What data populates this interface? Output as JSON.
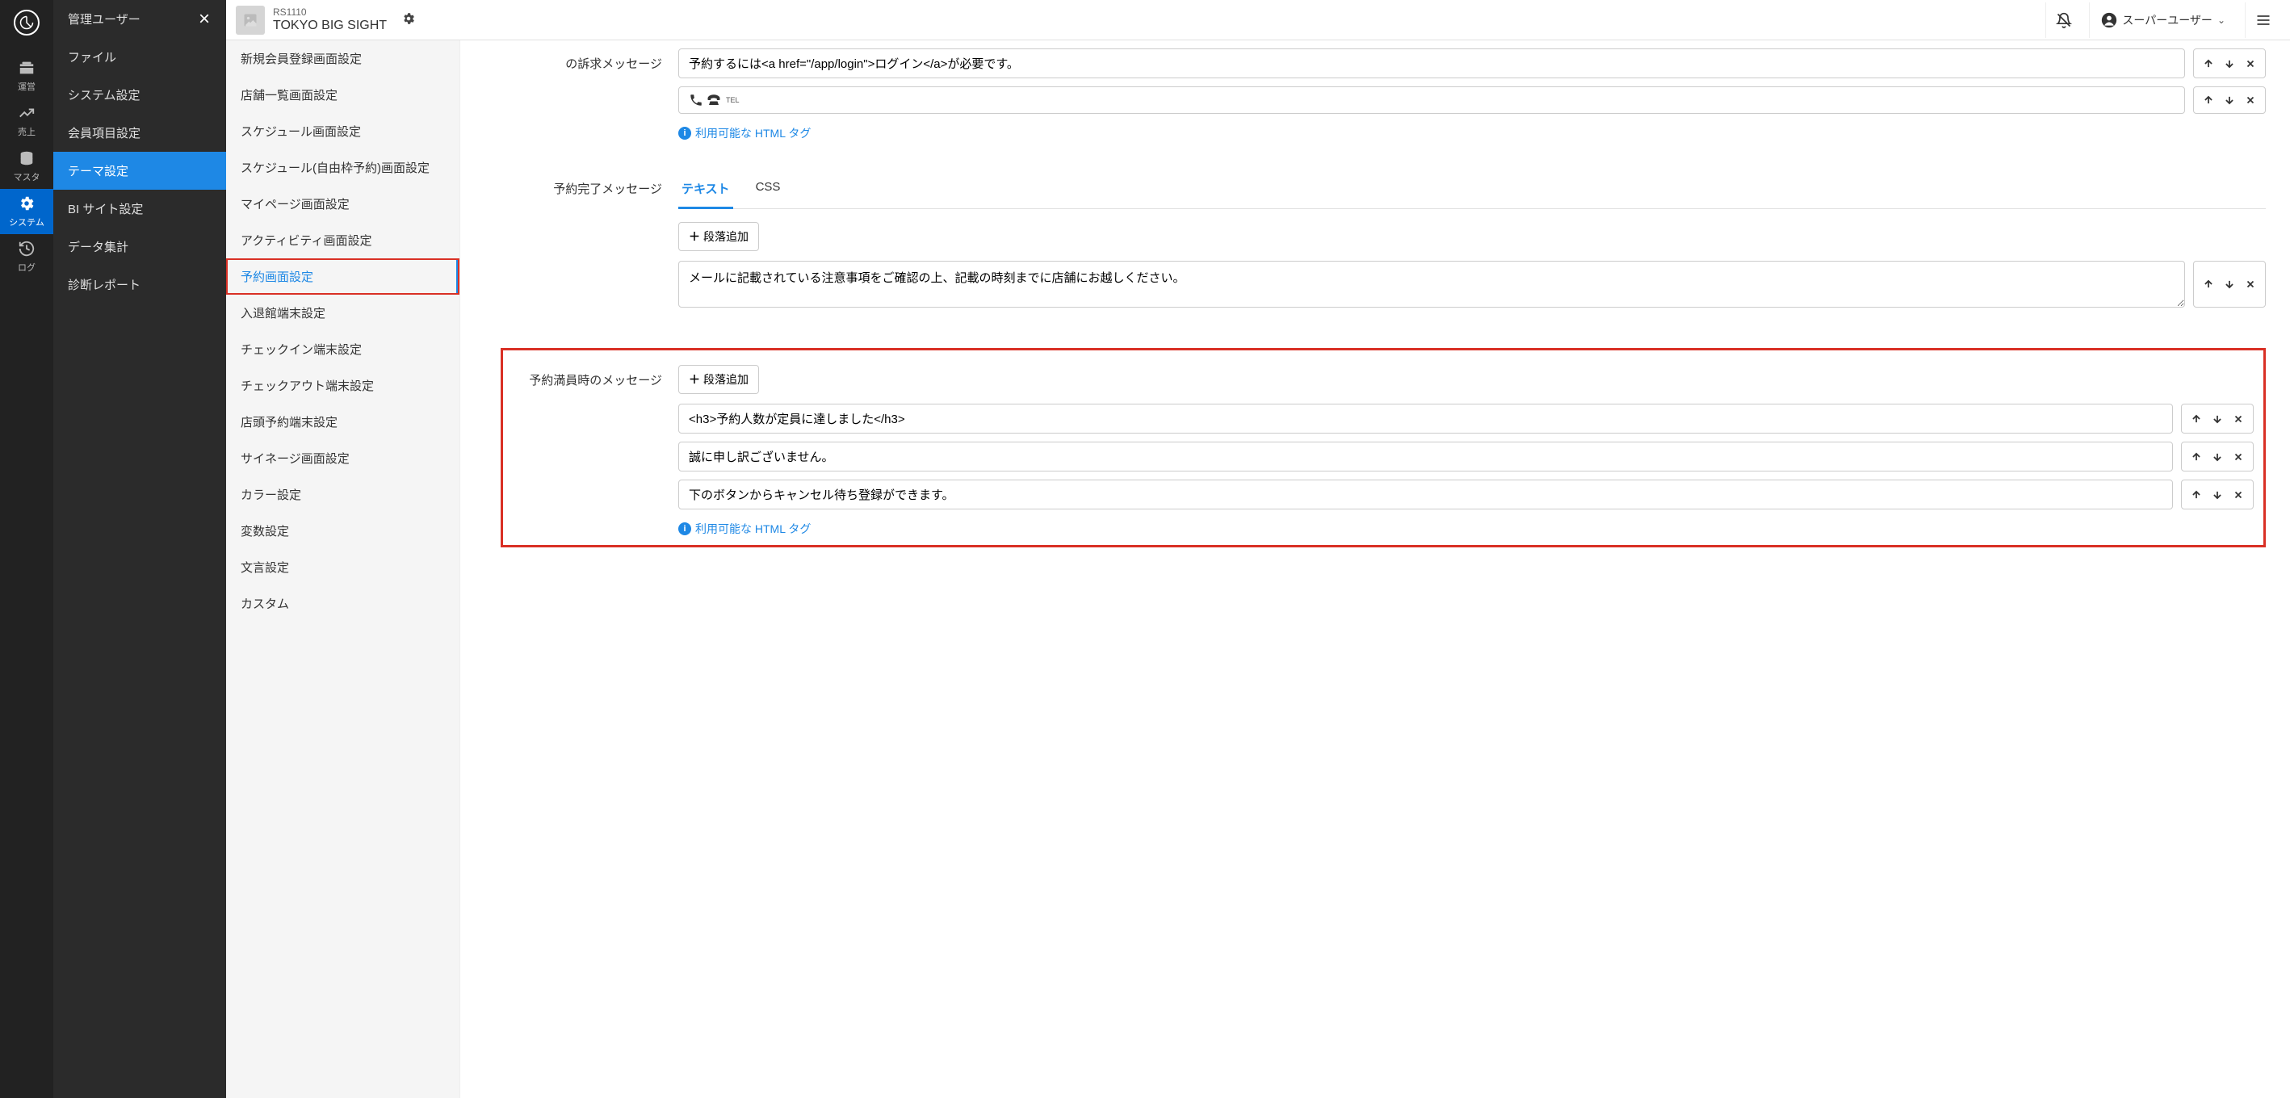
{
  "topbar": {
    "code": "RS1110",
    "name": "TOKYO BIG SIGHT",
    "thumb_label": "No image",
    "user_label": "スーパーユーザー"
  },
  "icon_nav": [
    {
      "label": "運営"
    },
    {
      "label": "売上"
    },
    {
      "label": "マスタ"
    },
    {
      "label": "システム"
    },
    {
      "label": "ログ"
    }
  ],
  "second_nav": [
    {
      "label": "管理ユーザー"
    },
    {
      "label": "ファイル"
    },
    {
      "label": "システム設定"
    },
    {
      "label": "会員項目設定"
    },
    {
      "label": "テーマ設定"
    },
    {
      "label": "BI サイト設定"
    },
    {
      "label": "データ集計"
    },
    {
      "label": "診断レポート"
    }
  ],
  "third_nav": [
    {
      "label": "新規会員登録画面設定"
    },
    {
      "label": "店舗一覧画面設定"
    },
    {
      "label": "スケジュール画面設定"
    },
    {
      "label": "スケジュール(自由枠予約)画面設定"
    },
    {
      "label": "マイページ画面設定"
    },
    {
      "label": "アクティビティ画面設定"
    },
    {
      "label": "予約画面設定"
    },
    {
      "label": "入退館端末設定"
    },
    {
      "label": "チェックイン端末設定"
    },
    {
      "label": "チェックアウト端末設定"
    },
    {
      "label": "店頭予約端末設定"
    },
    {
      "label": "サイネージ画面設定"
    },
    {
      "label": "カラー設定"
    },
    {
      "label": "変数設定"
    },
    {
      "label": "文言設定"
    },
    {
      "label": "カスタム"
    }
  ],
  "section1": {
    "label": "の訴求メッセージ",
    "input1": "予約するには<a href=\"/app/login\">ログイン</a>が必要です。",
    "tel_label": "TEL",
    "help": "利用可能な HTML タグ"
  },
  "section2": {
    "label": "予約完了メッセージ",
    "tab_text": "テキスト",
    "tab_css": "CSS",
    "add_btn": "段落追加",
    "input1": "メールに記載されている注意事項をご確認の上、記載の時刻までに店舗にお越しください。"
  },
  "section3": {
    "label": "予約満員時のメッセージ",
    "add_btn": "段落追加",
    "inputs": [
      "<h3>予約人数が定員に達しました</h3>",
      "誠に申し訳ございません。",
      "下のボタンからキャンセル待ち登録ができます。"
    ],
    "help": "利用可能な HTML タグ"
  }
}
